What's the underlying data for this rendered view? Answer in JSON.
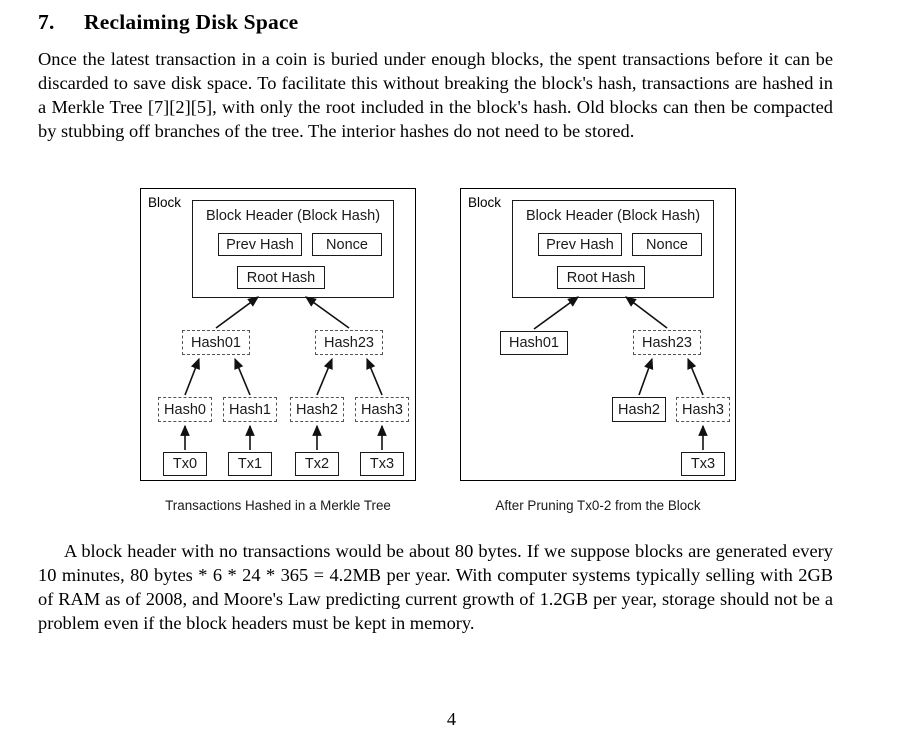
{
  "document": {
    "page_number": "4",
    "heading": {
      "number": "7.",
      "title": "Reclaiming Disk Space"
    },
    "paragraphs": {
      "intro": "Once the latest transaction in a coin is buried under enough blocks, the spent transactions before it can be discarded to save disk space.  To facilitate this without breaking the block's hash, transactions are hashed in a Merkle Tree [7][2][5], with only the root included in the block's hash.  Old blocks can then be compacted by stubbing off branches of the tree.  The interior hashes do not need to be stored.",
      "tail": "A block header with no transactions would be about 80 bytes.  If we suppose blocks are generated every 10 minutes, 80 bytes * 6 * 24 * 365 = 4.2MB per year.  With computer systems typically selling with 2GB of RAM as of 2008, and Moore's Law predicting current growth of 1.2GB per year, storage should not be a problem even if the block headers must be kept in memory."
    }
  },
  "figures": {
    "left": {
      "caption": "Transactions Hashed in a Merkle Tree",
      "block_label": "Block",
      "header_title": "Block Header (Block Hash)",
      "prev_hash": "Prev Hash",
      "nonce": "Nonce",
      "root_hash": "Root Hash",
      "hash01": "Hash01",
      "hash23": "Hash23",
      "hash0": "Hash0",
      "hash1": "Hash1",
      "hash2": "Hash2",
      "hash3": "Hash3",
      "tx0": "Tx0",
      "tx1": "Tx1",
      "tx2": "Tx2",
      "tx3": "Tx3"
    },
    "right": {
      "caption": "After Pruning Tx0-2 from the Block",
      "block_label": "Block",
      "header_title": "Block Header (Block Hash)",
      "prev_hash": "Prev Hash",
      "nonce": "Nonce",
      "root_hash": "Root Hash",
      "hash01": "Hash01",
      "hash23": "Hash23",
      "hash2": "Hash2",
      "hash3": "Hash3",
      "tx3": "Tx3"
    }
  },
  "colors": {
    "ink": "#000000",
    "node_border_solid": "#1a1a1a",
    "node_border_dashed": "#555555",
    "page_background": "#ffffff"
  }
}
